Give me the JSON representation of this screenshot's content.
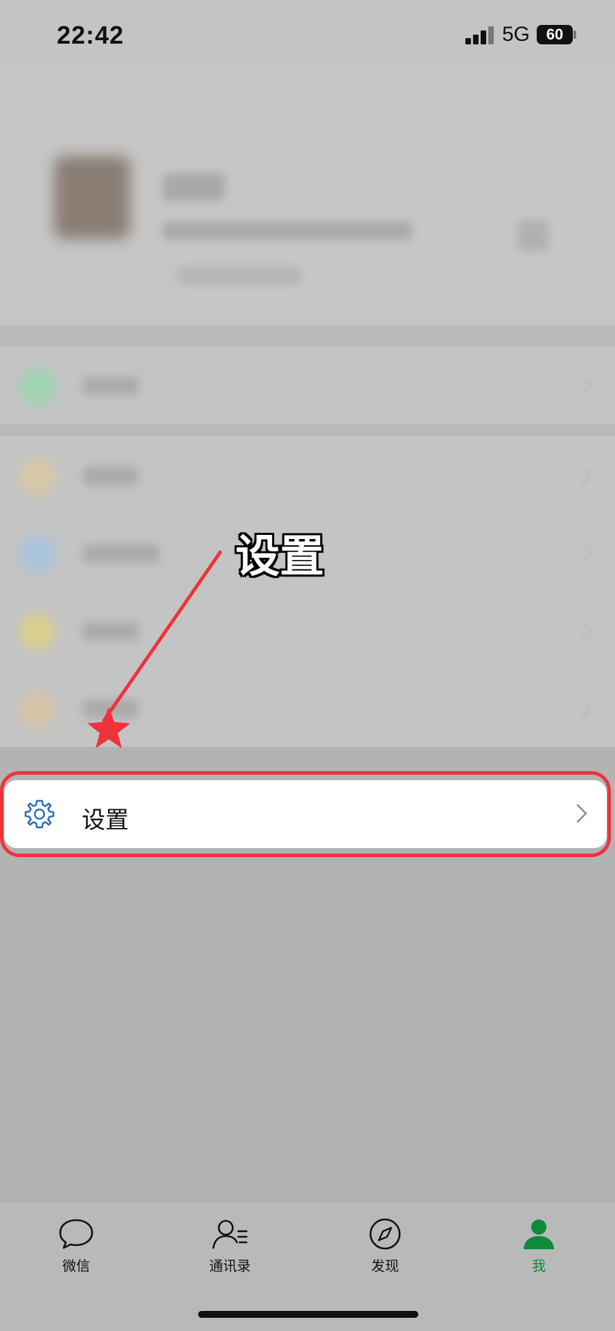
{
  "status_bar": {
    "time": "22:42",
    "network": "5G",
    "battery": "60"
  },
  "annotation": {
    "text": "设置",
    "arrow_color": "#f0323c"
  },
  "settings_item": {
    "label": "设置",
    "icon": "gear-icon",
    "highlight_color": "#f0323c"
  },
  "tab_bar": {
    "tabs": [
      {
        "label": "微信",
        "icon": "chat-bubble-icon",
        "active": false
      },
      {
        "label": "通讯录",
        "icon": "contacts-icon",
        "active": false
      },
      {
        "label": "发现",
        "icon": "compass-icon",
        "active": false
      },
      {
        "label": "我",
        "icon": "person-icon",
        "active": true
      }
    ],
    "active_color": "#0d8a3a"
  }
}
